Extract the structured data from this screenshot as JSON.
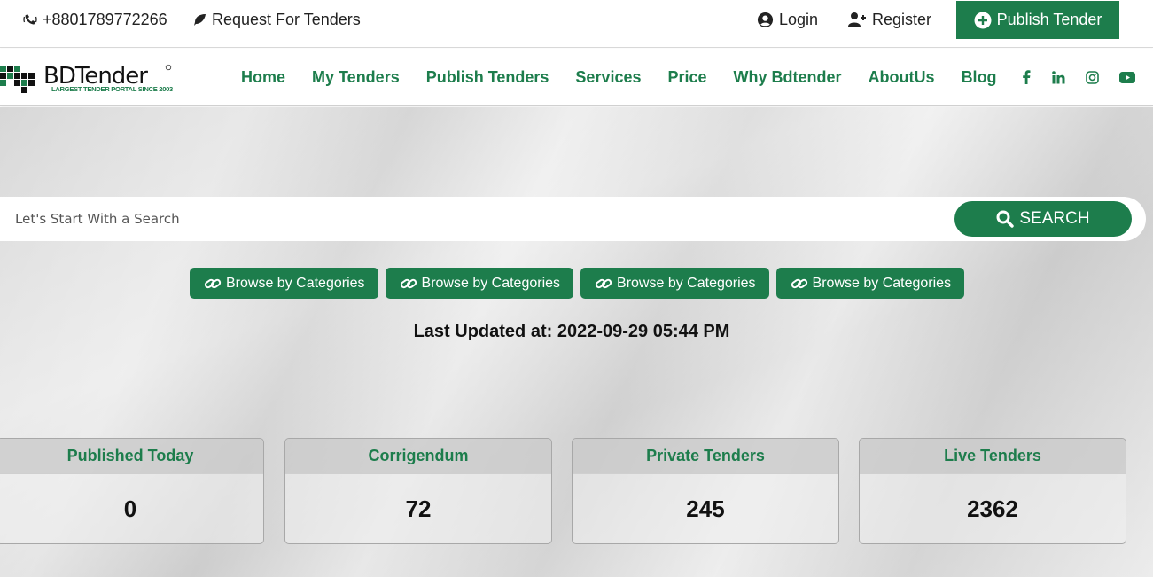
{
  "topbar": {
    "phone": "+8801789772266",
    "request": "Request For Tenders",
    "login": "Login",
    "register": "Register",
    "publish": "Publish Tender"
  },
  "logo": {
    "brand": "BDTender",
    "tagline": "LARGEST TENDER PORTAL SINCE 2003"
  },
  "nav": {
    "items": [
      "Home",
      "My Tenders",
      "Publish Tenders",
      "Services",
      "Price",
      "Why Bdtender",
      "AboutUs",
      "Blog"
    ]
  },
  "socials": [
    "facebook-icon",
    "linkedin-icon",
    "instagram-icon",
    "youtube-icon"
  ],
  "search": {
    "placeholder": "Let's Start With a Search",
    "button": "SEARCH"
  },
  "browse": [
    "Browse by Categories",
    "Browse by Categories",
    "Browse by Categories",
    "Browse by Categories"
  ],
  "updated": "Last Updated at: 2022-09-29 05:44 PM",
  "stats": [
    {
      "label": "Published Today",
      "value": "0"
    },
    {
      "label": "Corrigendum",
      "value": "72"
    },
    {
      "label": "Private Tenders",
      "value": "245"
    },
    {
      "label": "Live Tenders",
      "value": "2362"
    }
  ],
  "colors": {
    "brand": "#1d7d4c"
  }
}
